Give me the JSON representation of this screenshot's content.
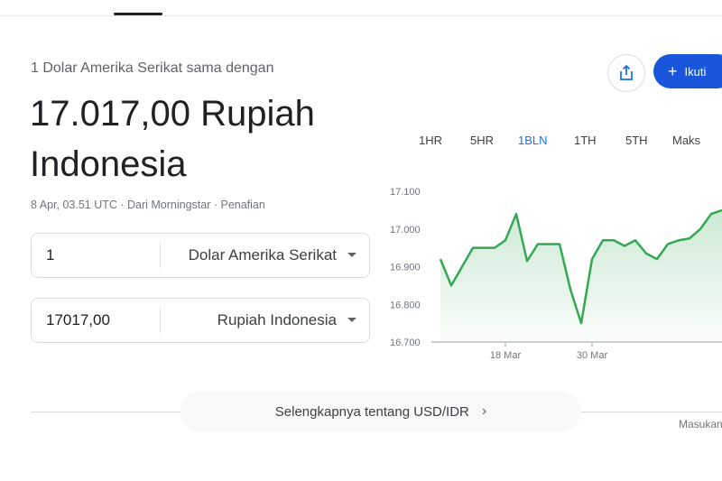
{
  "header": {
    "active_tab_index": 0
  },
  "converter": {
    "subtitle": "1 Dolar Amerika Serikat sama dengan",
    "result_line1": "17.017,00 Rupiah",
    "result_line2": "Indonesia",
    "meta": "8 Apr, 03.51 UTC · Dari Morningstar · Penafian",
    "from": {
      "amount": "1",
      "currency": "Dolar Amerika Serikat"
    },
    "to": {
      "amount": "17017,00",
      "currency": "Rupiah Indonesia"
    }
  },
  "actions": {
    "follow_label": "Ikuti",
    "share_icon": "share-icon"
  },
  "range_tabs": [
    {
      "label": "1HR",
      "active": false
    },
    {
      "label": "5HR",
      "active": false
    },
    {
      "label": "1BLN",
      "active": true
    },
    {
      "label": "1TH",
      "active": false
    },
    {
      "label": "5TH",
      "active": false
    },
    {
      "label": "Maks",
      "active": false
    }
  ],
  "chart_data": {
    "type": "area",
    "y_ticks": [
      "17.100",
      "17.000",
      "16.900",
      "16.800",
      "16.700"
    ],
    "y_tick_values": [
      17100,
      17000,
      16900,
      16800,
      16700
    ],
    "ylim": [
      16700,
      17100
    ],
    "x_tick_labels": [
      "18 Mar",
      "30 Mar"
    ],
    "x_tick_indices": [
      6,
      14
    ],
    "series": [
      {
        "values": [
          16920,
          16850,
          16900,
          16950,
          16950,
          16950,
          16970,
          17040,
          16915,
          16960,
          16960,
          16960,
          16840,
          16750,
          16920,
          16970,
          16970,
          16955,
          16970,
          16935,
          16920,
          16960,
          16970,
          16975,
          17000,
          17040,
          17050
        ]
      }
    ],
    "line_color": "#34a853",
    "grid": false
  },
  "more_link": {
    "label": "Selengkapnya tentang USD/IDR",
    "chevron": "chevron-right-icon"
  },
  "feedback": {
    "label": "Masukan"
  }
}
